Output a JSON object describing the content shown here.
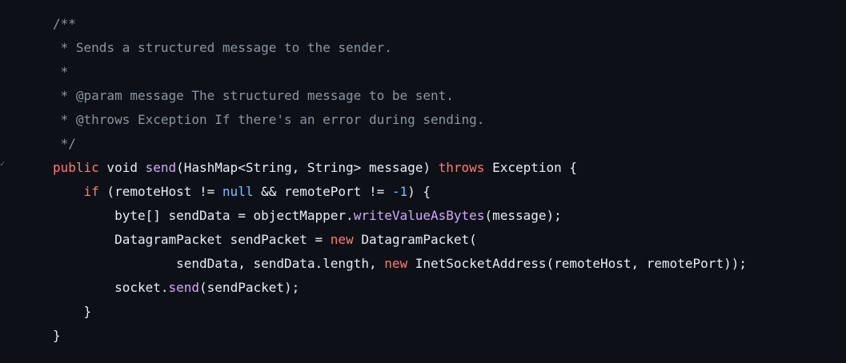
{
  "editor": {
    "background": "#0d1117",
    "colors": {
      "plain": "#e6edf3",
      "comment": "#8b949e",
      "keyword": "#ff7b72",
      "function": "#d2a8ff",
      "constant": "#79c0ff"
    },
    "gutter_mark": "✓",
    "lines": [
      [
        {
          "t": "comment",
          "v": "/**"
        }
      ],
      [
        {
          "t": "comment",
          "v": " * Sends a structured message to the sender."
        }
      ],
      [
        {
          "t": "comment",
          "v": " *"
        }
      ],
      [
        {
          "t": "comment",
          "v": " * @param message The structured message to be sent."
        }
      ],
      [
        {
          "t": "comment",
          "v": " * @throws Exception If there's an error during sending."
        }
      ],
      [
        {
          "t": "comment",
          "v": " */"
        }
      ],
      [
        {
          "t": "keyword",
          "v": "public"
        },
        {
          "t": "plain",
          "v": " void "
        },
        {
          "t": "function",
          "v": "send"
        },
        {
          "t": "plain",
          "v": "(HashMap<String, String> message) "
        },
        {
          "t": "keyword",
          "v": "throws"
        },
        {
          "t": "plain",
          "v": " Exception {"
        }
      ],
      [
        {
          "t": "plain",
          "v": "    "
        },
        {
          "t": "keyword",
          "v": "if"
        },
        {
          "t": "plain",
          "v": " (remoteHost != "
        },
        {
          "t": "constant",
          "v": "null"
        },
        {
          "t": "plain",
          "v": " && remotePort != "
        },
        {
          "t": "number",
          "v": "-1"
        },
        {
          "t": "plain",
          "v": ") {"
        }
      ],
      [
        {
          "t": "plain",
          "v": "        byte[] sendData = objectMapper."
        },
        {
          "t": "function",
          "v": "writeValueAsBytes"
        },
        {
          "t": "plain",
          "v": "(message);"
        }
      ],
      [
        {
          "t": "plain",
          "v": "        DatagramPacket sendPacket = "
        },
        {
          "t": "keyword",
          "v": "new"
        },
        {
          "t": "plain",
          "v": " DatagramPacket("
        }
      ],
      [
        {
          "t": "plain",
          "v": "                sendData, sendData.length, "
        },
        {
          "t": "keyword",
          "v": "new"
        },
        {
          "t": "plain",
          "v": " InetSocketAddress(remoteHost, remotePort));"
        }
      ],
      [
        {
          "t": "plain",
          "v": "        socket."
        },
        {
          "t": "function",
          "v": "send"
        },
        {
          "t": "plain",
          "v": "(sendPacket);"
        }
      ],
      [
        {
          "t": "plain",
          "v": "    }"
        }
      ],
      [
        {
          "t": "plain",
          "v": "}"
        }
      ]
    ]
  }
}
